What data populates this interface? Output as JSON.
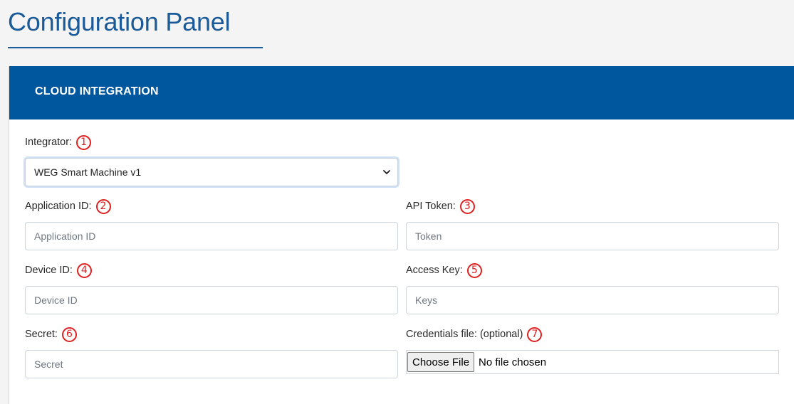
{
  "page": {
    "title": "Configuration Panel"
  },
  "card": {
    "header": "CLOUD INTEGRATION"
  },
  "fields": {
    "integrator": {
      "label": "Integrator:",
      "badge": "1",
      "selected": "WEG Smart Machine v1"
    },
    "application_id": {
      "label": "Application ID:",
      "badge": "2",
      "placeholder": "Application ID"
    },
    "api_token": {
      "label": "API Token:",
      "badge": "3",
      "placeholder": "Token"
    },
    "device_id": {
      "label": "Device ID:",
      "badge": "4",
      "placeholder": "Device ID"
    },
    "access_key": {
      "label": "Access Key:",
      "badge": "5",
      "placeholder": "Keys"
    },
    "secret": {
      "label": "Secret:",
      "badge": "6",
      "placeholder": "Secret"
    },
    "credentials_file": {
      "label": "Credentials file: (optional)",
      "badge": "7",
      "button": "Choose File",
      "status": "No file chosen"
    }
  },
  "icons": {
    "select_chevron": "chevron-down-icon"
  },
  "colors": {
    "brand_blue": "#00579d",
    "title_blue": "#1a5a99",
    "annotation_red": "#e02020"
  }
}
